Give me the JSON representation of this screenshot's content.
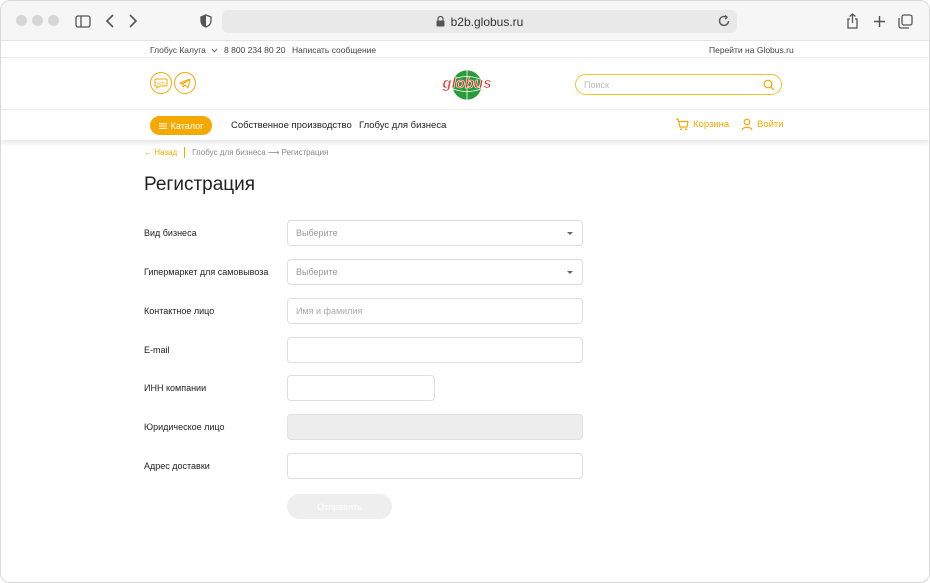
{
  "browser": {
    "url": "b2b.globus.ru"
  },
  "infobar": {
    "city": "Глобус Калуга",
    "phone": "8 800 234 80 20",
    "message_link": "Написать сообщение",
    "main_site_link": "Перейти на Globus.ru"
  },
  "header": {
    "logo_text": "Globus",
    "search_placeholder": "Поиск"
  },
  "nav": {
    "catalog_label": "Каталог",
    "links": [
      "Собственное производство",
      "Глобус для бизнеса"
    ],
    "cart_label": "Корзина",
    "login_label": "Войти"
  },
  "breadcrumb": {
    "back": "← Назад",
    "path": "Глобус для бизнеса ⟶ Регистрация"
  },
  "page": {
    "title": "Регистрация"
  },
  "form": {
    "fields": [
      {
        "label": "Вид бизнеса",
        "placeholder": "Выберите"
      },
      {
        "label": "Гипермаркет для самовывоза",
        "placeholder": "Выберите"
      },
      {
        "label": "Контактное лицо",
        "placeholder": "Имя и фамилия"
      },
      {
        "label": "E-mail",
        "placeholder": ""
      },
      {
        "label": "ИНН компании",
        "placeholder": ""
      },
      {
        "label": "Юридическое лицо",
        "placeholder": ""
      },
      {
        "label": "Адрес доставки",
        "placeholder": ""
      }
    ],
    "submit_label": "Отправить"
  },
  "colors": {
    "accent": "#f4a900",
    "logo_green": "#2a9a3a",
    "logo_red": "#e3342f"
  }
}
